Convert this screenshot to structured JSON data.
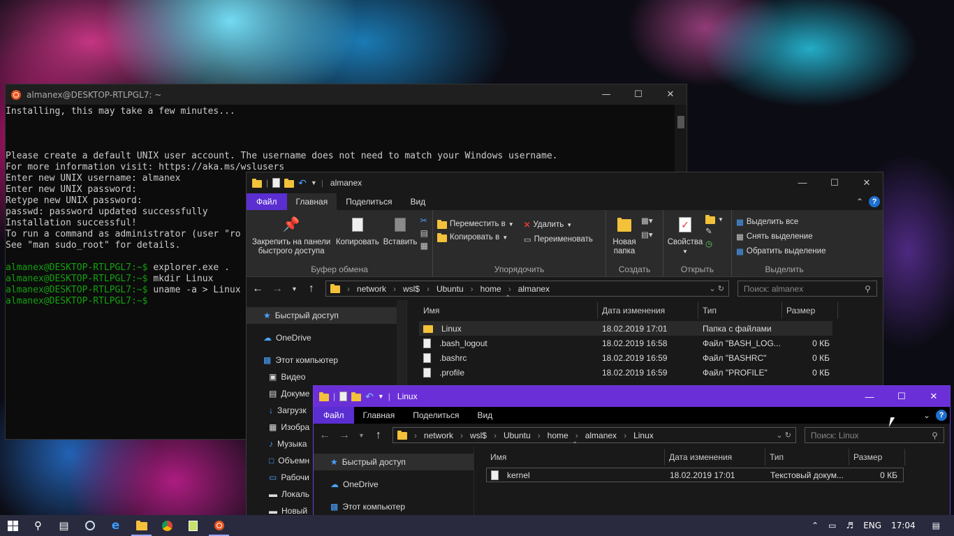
{
  "terminal": {
    "title": "almanex@DESKTOP-RTLPGL7: ~",
    "lines": [
      "Installing, this may take a few minutes...",
      "",
      "",
      "",
      "Please create a default UNIX user account. The username does not need to match your Windows username.",
      "For more information visit: https://aka.ms/wslusers",
      "Enter new UNIX username: almanex",
      "Enter new UNIX password:",
      "Retype new UNIX password:",
      "passwd: password updated successfully",
      "Installation successful!",
      "To run a command as administrator (user \"ro",
      "See \"man sudo_root\" for details.",
      ""
    ],
    "prompt": "almanex@DESKTOP-RTLPGL7:~$",
    "commands": [
      "explorer.exe .",
      "mkdir Linux",
      "uname -a > Linux",
      ""
    ]
  },
  "explorer1": {
    "title": "almanex",
    "menu": {
      "file": "Файл",
      "home": "Главная",
      "share": "Поделиться",
      "view": "Вид"
    },
    "ribbon": {
      "pin": "Закрепить на панели быстрого доступа",
      "copy": "Копировать",
      "paste": "Вставить",
      "clipboard": "Буфер обмена",
      "move_to": "Переместить в",
      "copy_to": "Копировать в",
      "delete": "Удалить",
      "rename": "Переименовать",
      "organize": "Упорядочить",
      "new_folder": "Новая папка",
      "create": "Создать",
      "properties": "Свойства",
      "open": "Открыть",
      "select_all": "Выделить все",
      "select_none": "Снять выделение",
      "invert": "Обратить выделение",
      "select": "Выделить"
    },
    "path": [
      "network",
      "wsl$",
      "Ubuntu",
      "home",
      "almanex"
    ],
    "search_placeholder": "Поиск: almanex",
    "nav": [
      "Быстрый доступ",
      "OneDrive",
      "Этот компьютер",
      "Видео",
      "Докуме",
      "Загрузк",
      "Изобра",
      "Музыка",
      "Объемн",
      "Рабочи",
      "Локаль",
      "Новый"
    ],
    "columns": {
      "name": "Имя",
      "date": "Дата изменения",
      "type": "Тип",
      "size": "Размер"
    },
    "files": [
      {
        "name": "Linux",
        "date": "18.02.2019 17:01",
        "type": "Папка с файлами",
        "size": ""
      },
      {
        "name": ".bash_logout",
        "date": "18.02.2019 16:58",
        "type": "Файл \"BASH_LOG...",
        "size": "0 КБ"
      },
      {
        "name": ".bashrc",
        "date": "18.02.2019 16:59",
        "type": "Файл \"BASHRC\"",
        "size": "0 КБ"
      },
      {
        "name": ".profile",
        "date": "18.02.2019 16:59",
        "type": "Файл \"PROFILE\"",
        "size": "0 КБ"
      }
    ]
  },
  "explorer2": {
    "title": "Linux",
    "menu": {
      "file": "Файл",
      "home": "Главная",
      "share": "Поделиться",
      "view": "Вид"
    },
    "path": [
      "network",
      "wsl$",
      "Ubuntu",
      "home",
      "almanex",
      "Linux"
    ],
    "search_placeholder": "Поиск: Linux",
    "nav": [
      "Быстрый доступ",
      "OneDrive",
      "Этот компьютер"
    ],
    "columns": {
      "name": "Имя",
      "date": "Дата изменения",
      "type": "Тип",
      "size": "Размер"
    },
    "files": [
      {
        "name": "kernel",
        "date": "18.02.2019 17:01",
        "type": "Текстовый докум...",
        "size": "0 КБ"
      }
    ]
  },
  "taskbar": {
    "lang": "ENG",
    "time": "17:04"
  }
}
